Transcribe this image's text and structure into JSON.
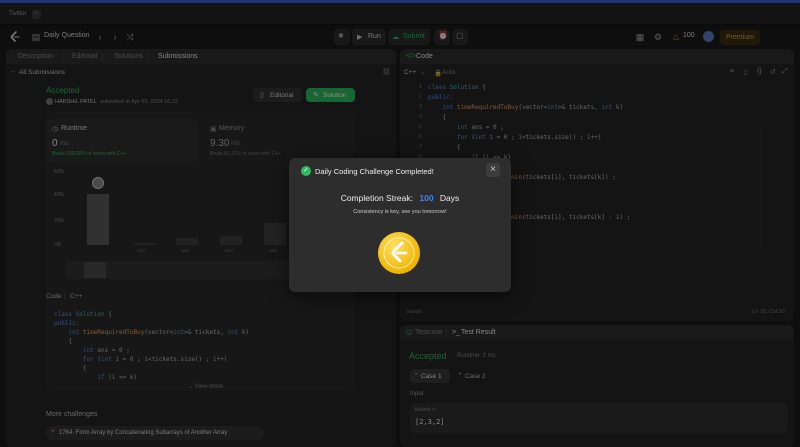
{
  "browser": {
    "tab_title": "Twitter",
    "tab_close": "×"
  },
  "nav": {
    "problem_list": "Daily Question",
    "run_label": "Run",
    "submit_label": "Submit",
    "coins": "100",
    "premium_label": "Premium"
  },
  "left_panel": {
    "tabs": [
      "Description",
      "Editorial",
      "Solutions",
      "Submissions"
    ],
    "back_label": "All Submissions",
    "status": "Accepted",
    "author": "HARSHIL PATEL",
    "submitted": "submitted at Apr 05, 2024 16:23",
    "editorial_btn": "Editorial",
    "solution_btn": "Solution",
    "runtime_title": "Runtime",
    "runtime_value": "0",
    "runtime_unit": "ms",
    "runtime_beats": "Beats 100.00% of users with C++",
    "memory_title": "Memory",
    "memory_value": "9.30",
    "memory_unit": "MB",
    "memory_beats": "Beats 81.11% of users with C++",
    "chart_ticks_y": [
      "60%",
      "40%",
      "20%",
      "0%"
    ],
    "chart_ticks_x": [
      "1ms",
      "2ms",
      "3ms",
      "4ms"
    ],
    "code_label": "Code",
    "code_lang": "C++",
    "code_lines": [
      "class Solution {",
      "public:",
      "    int timeRequiredToBuy(vector<int>& tickets, int k)",
      "    {",
      "        int ans = 0 ;",
      "        for (int i = 0 ; i<tickets.size() ; i++)",
      "        {",
      "            if (i <= k)"
    ],
    "view_more": "View more",
    "more_challenges": "More challenges",
    "challenge_item": "1764. Form Array by Concatenating Subarrays of Another Array"
  },
  "code_panel": {
    "title": "Code",
    "lang": "C++",
    "auto": "Auto",
    "line_numbers": [
      "1",
      "2",
      "3",
      "4",
      "5",
      "6",
      "7",
      "8",
      "9",
      "10",
      "11",
      "12",
      "13",
      "14",
      "15",
      "16",
      "17",
      "18"
    ],
    "lines": [
      "class Solution {",
      "public:",
      "    int timeRequiredToBuy(vector<int>& tickets, int k)",
      "    {",
      "        int ans = 0 ;",
      "        for (int i = 0 ; i<tickets.size() ; i++)",
      "        {",
      "            if (i <= k)",
      "            {",
      "                ans += min(tickets[i], tickets[k]) ;",
      "            }",
      "            else",
      "            {",
      "                ans += min(tickets[i], tickets[k] - 1) ;",
      "            }",
      "        }",
      "        return ans;",
      "    }"
    ],
    "saved": "Saved",
    "cursor_pos": "Ln 18, Col 20"
  },
  "test_panel": {
    "tab_testcase": "Testcase",
    "tab_result": "Test Result",
    "status": "Accepted",
    "runtime": "Runtime: 3 ms",
    "case1": "Case 1",
    "case2": "Case 2",
    "input_label": "Input",
    "var_name": "tickets =",
    "var_value": "[2,3,2]"
  },
  "modal": {
    "title": "Daily Coding Challenge Completed!",
    "streak_label": "Completion Streak:",
    "streak_value": "100",
    "streak_unit": "Days",
    "subtitle": "Consistency is key, see you tomorrow!",
    "close_icon": "×"
  },
  "colors": {
    "accent_green": "#2cbb5d",
    "accent_blue": "#3b82f6",
    "coin_gold": "#f0b400",
    "premium_orange": "#f0a826"
  }
}
